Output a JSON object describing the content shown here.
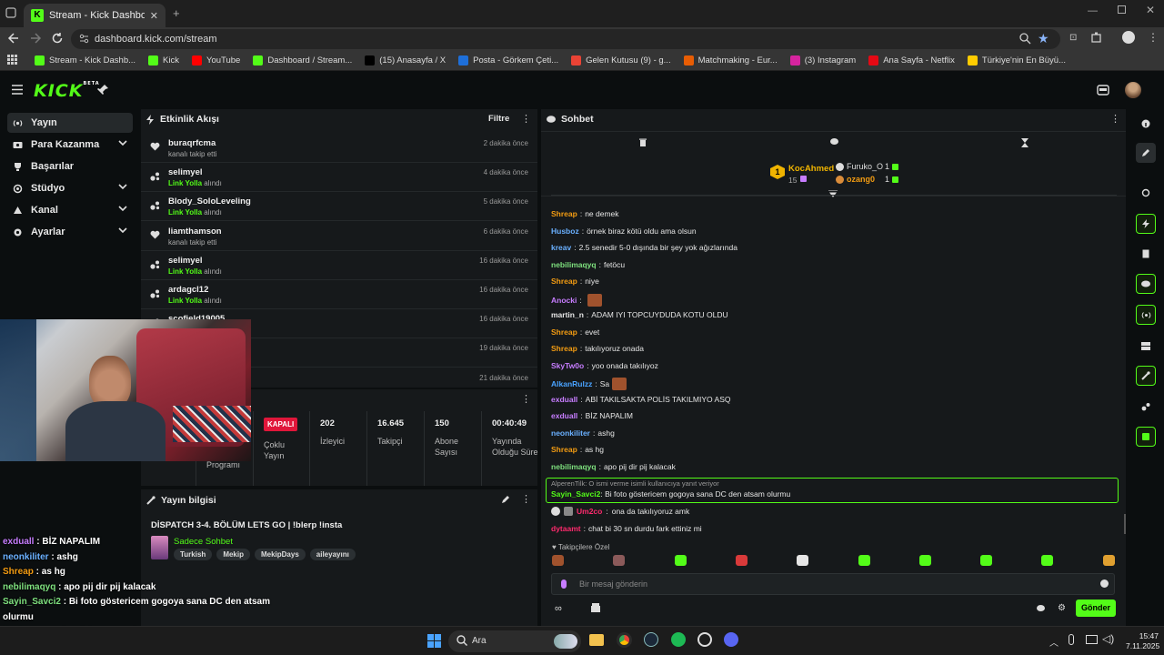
{
  "browser": {
    "tab_title": "Stream - Kick Dashboard",
    "url": "dashboard.kick.com/stream",
    "bookmarks": [
      {
        "label": "Stream - Kick Dashb...",
        "color": "#53fc18"
      },
      {
        "label": "Kick",
        "color": "#53fc18"
      },
      {
        "label": "YouTube",
        "color": "#ff0000"
      },
      {
        "label": "Dashboard / Stream...",
        "color": "#53fc18"
      },
      {
        "label": "(15) Anasayfa / X",
        "color": "#000000"
      },
      {
        "label": "Posta - Görkem Çeti...",
        "color": "#1e6fd9"
      },
      {
        "label": "Gelen Kutusu (9) - g...",
        "color": "#ea4335"
      },
      {
        "label": "Matchmaking - Eur...",
        "color": "#e85d04"
      },
      {
        "label": "(3) Instagram",
        "color": "#d6249f"
      },
      {
        "label": "Ana Sayfa - Netflix",
        "color": "#e50914"
      },
      {
        "label": "Türkiye'nin En Büyü...",
        "color": "#ffcc00"
      }
    ]
  },
  "header": {
    "logo": "KICK",
    "logo_tag": "BETA"
  },
  "sidebar": {
    "items": [
      {
        "label": "Yayın",
        "icon": "broadcast-icon",
        "active": true,
        "chevron": false
      },
      {
        "label": "Para Kazanma",
        "icon": "money-icon",
        "chevron": true
      },
      {
        "label": "Başarılar",
        "icon": "trophy-icon",
        "chevron": false
      },
      {
        "label": "Stüdyo",
        "icon": "studio-icon",
        "chevron": true
      },
      {
        "label": "Kanal",
        "icon": "channel-icon",
        "chevron": true
      },
      {
        "label": "Ayarlar",
        "icon": "gear-icon",
        "chevron": true
      }
    ]
  },
  "activity": {
    "title": "Etkinlik Akışı",
    "filter_label": "Filtre",
    "items": [
      {
        "name": "buraqrfcma",
        "action": "kanalı takip etti",
        "highlight": "",
        "time": "2 dakika önce",
        "type": "follow"
      },
      {
        "name": "selimyel",
        "action": "alındı",
        "highlight": "Link Yolla",
        "time": "4 dakika önce",
        "type": "reward"
      },
      {
        "name": "Blody_SoloLeveling",
        "action": "alındı",
        "highlight": "Link Yolla",
        "time": "5 dakika önce",
        "type": "reward"
      },
      {
        "name": "liamthamson",
        "action": "kanalı takip etti",
        "highlight": "",
        "time": "6 dakika önce",
        "type": "follow"
      },
      {
        "name": "selimyel",
        "action": "alındı",
        "highlight": "Link Yolla",
        "time": "16 dakika önce",
        "type": "reward"
      },
      {
        "name": "ardagcl12",
        "action": "alındı",
        "highlight": "Link Yolla",
        "time": "16 dakika önce",
        "type": "reward"
      },
      {
        "name": "scofield19005",
        "action": "",
        "highlight": "",
        "time": "16 dakika önce",
        "type": "reward"
      },
      {
        "name": "",
        "action": "",
        "highlight": "",
        "time": "19 dakika önce",
        "type": "reward"
      },
      {
        "name": "",
        "action": "",
        "highlight": "",
        "time": "21 dakika önce",
        "type": "reward"
      }
    ]
  },
  "stats": {
    "status": "KAPALI",
    "multistream_label": "Çoklu Yayın",
    "program_label": "Programı",
    "items": [
      {
        "value": "202",
        "label": "İzleyici"
      },
      {
        "value": "16.645",
        "label": "Takipçi"
      },
      {
        "value": "150",
        "label": "Abone Sayısı"
      },
      {
        "value": "00:40:49",
        "label": "Yayında Olduğu Süre"
      }
    ]
  },
  "stream_info": {
    "title": "Yayın bilgisi",
    "stream_title": "DİSPATCH 3-4. BÖLÜM LETS GO | !blerp !insta",
    "category": "Sadece Sohbet",
    "tags": [
      "Turkish",
      "Mekip",
      "MekipDays",
      "aileyayını"
    ]
  },
  "chat": {
    "title": "Sohbet",
    "leaderboard": {
      "top_name": "KocAhmed",
      "top_count": "15",
      "second_name": "Furuko_O",
      "second_count": "1",
      "third_name": "ozang0",
      "third_count": "1"
    },
    "messages": [
      {
        "user": "Shreap",
        "color": "#f39c12",
        "text": "ne demek"
      },
      {
        "user": "Husboz",
        "color": "#6ab0ff",
        "text": "örnek biraz kötü oldu ama olsun"
      },
      {
        "user": "kreav",
        "color": "#6ab0ff",
        "text": "2.5 senedir 5-0 dışında bir şey yok ağızlarında"
      },
      {
        "user": "nebilimaqyq",
        "color": "#7ee07e",
        "text": "fetöcu"
      },
      {
        "user": "Shreap",
        "color": "#f39c12",
        "text": "niye"
      },
      {
        "user": "Anocki",
        "color": "#c77dff",
        "text": "",
        "emote": true
      },
      {
        "user": "martin_n",
        "color": "#e6e6e6",
        "text": "ADAM IYI TOPCUYDUDA KOTU OLDU"
      },
      {
        "user": "Shreap",
        "color": "#f39c12",
        "text": "evet"
      },
      {
        "user": "Shreap",
        "color": "#f39c12",
        "text": "takılıyoruz onada"
      },
      {
        "user": "SkyTw0o",
        "color": "#c77dff",
        "text": "yoo onada takılıyoz"
      },
      {
        "user": "AlkanRulzz",
        "color": "#4aa3ff",
        "text": "Sa",
        "emote": true
      },
      {
        "user": "exduall",
        "color": "#c77dff",
        "text": "ABİ TAKILSAKTA POLİS TAKILMIYO ASQ"
      },
      {
        "user": "exduall",
        "color": "#c77dff",
        "text": "BİZ NAPALIM"
      },
      {
        "user": "neonkiliter",
        "color": "#6ab0ff",
        "text": "ashg"
      },
      {
        "user": "Shreap",
        "color": "#f39c12",
        "text": "as hg"
      },
      {
        "user": "nebilimaqyq",
        "color": "#7ee07e",
        "text": "apo pij dir pij kalacak"
      }
    ],
    "reply": {
      "context": "AlperenTilk: O ismi verme isimli kullanıcıya yanıt veriyor",
      "user": "Sayin_Savci2",
      "text": "Bi foto göstericem gogoya sana DC den atsam olurmu"
    },
    "after": [
      {
        "user": "Um2co",
        "color": "#ff2a6d",
        "text": "ona da takılıyoruz amk"
      },
      {
        "user": "dytaamt",
        "color": "#ff2a6d",
        "text": "chat bi 30 sn durdu fark ettiniz mi"
      }
    ],
    "emote_bar_label": "Takipçilere Özel",
    "input_placeholder": "Bir mesaj gönderin",
    "send_label": "Gönder"
  },
  "overlay": {
    "lines": [
      {
        "user": "exduall",
        "color": "#c77dff",
        "text": " : BİZ NAPALIM"
      },
      {
        "user": "neonkiliter",
        "color": "#6ab0ff",
        "text": " : ashg"
      },
      {
        "user": "Shreap",
        "color": "#f39c12",
        "text": " : as hg"
      },
      {
        "user": "nebilimaqyq",
        "color": "#7ee07e",
        "text": " : apo pij dir pij kalacak"
      },
      {
        "user": "Sayin_Savci2",
        "color": "#7ee07e",
        "text": " : Bi foto göstericem gogoya sana DC den atsam"
      },
      {
        "user": "",
        "color": "#ffffff",
        "text": "olurmu"
      },
      {
        "user": "Um2co",
        "color": "#ff2a6d",
        "text": " : ona da takılıyoruz amk"
      },
      {
        "user": "dytsamt",
        "color": "#ff2a6d",
        "text": " : chat bi 30 sn durdu fark ettiniz mi"
      }
    ]
  },
  "taskbar": {
    "search_label": "Ara",
    "time": "15:47",
    "date": "7.11.2025"
  },
  "colors": {
    "accent": "#53fc18",
    "panel": "#16191b",
    "background": "#0b0e0f"
  }
}
